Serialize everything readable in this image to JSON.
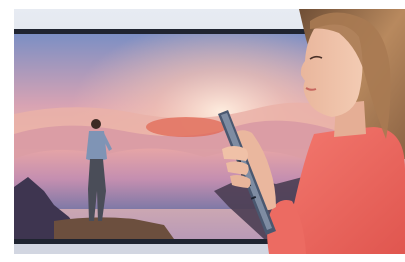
{
  "scene": {
    "tv_screen": {
      "content": "hiker-on-cliff-above-clouds",
      "palette": [
        "#f4b6ac",
        "#e58a7c",
        "#8a6d9c",
        "#4f4168",
        "#2b2b3c"
      ]
    },
    "accent_colors": {
      "room": "#d9dee9",
      "tv_bezel": "#1f2430",
      "blouse": "#f06a63",
      "hair": "#b8895e",
      "remote": "#4a5870"
    }
  }
}
